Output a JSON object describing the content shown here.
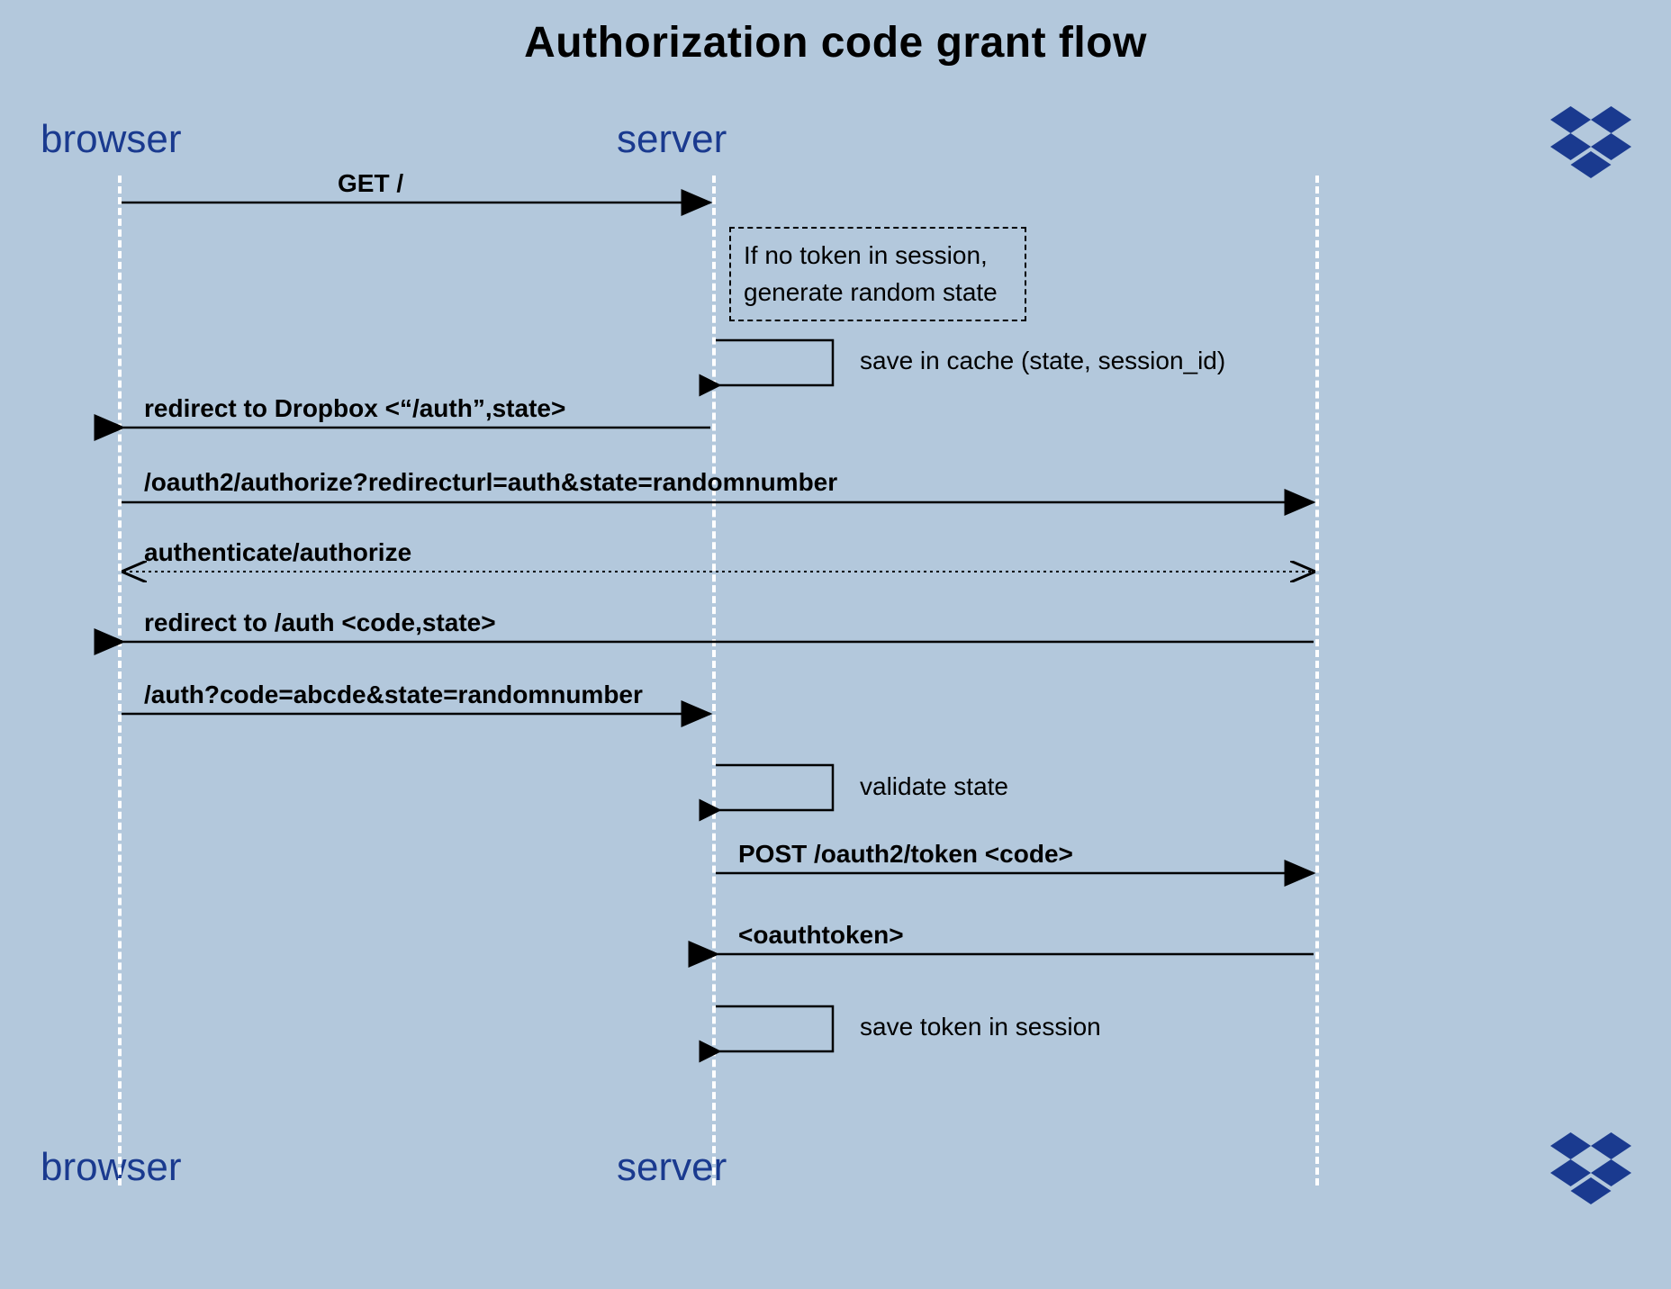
{
  "title": "Authorization code grant flow",
  "actors": {
    "browser_top": "browser",
    "server_top": "server",
    "browser_bottom": "browser",
    "server_bottom": "server"
  },
  "messages": {
    "get_root": "GET /",
    "note_no_token_l1": "If no token in session,",
    "note_no_token_l2": "generate random state",
    "save_cache": "save in cache (state, session_id)",
    "redirect_dropbox": "redirect to Dropbox <“/auth”,state>",
    "oauth_authorize": "/oauth2/authorize?redirecturl=auth&state=randomnumber",
    "authenticate": "authenticate/authorize",
    "redirect_auth": "redirect to /auth <code,state>",
    "auth_code": "/auth?code=abcde&state=randomnumber",
    "validate_state": "validate state",
    "post_token": "POST /oauth2/token <code>",
    "oauthtoken": "<oauthtoken>",
    "save_token": "save token in session"
  },
  "colors": {
    "bg": "#b3c8dc",
    "actor": "#1a3a8f",
    "dropbox": "#1a3a8f"
  }
}
